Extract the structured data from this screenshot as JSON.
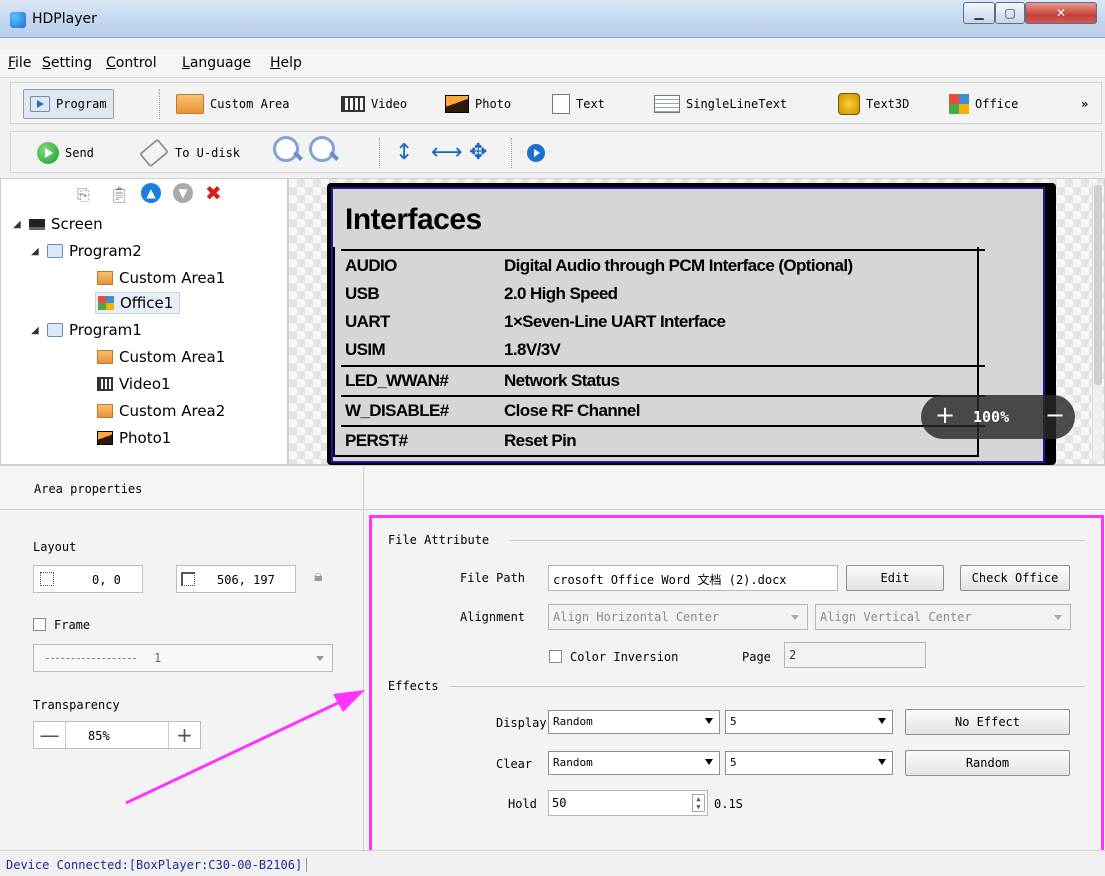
{
  "window": {
    "title": "HDPlayer"
  },
  "menu": [
    "File",
    "Setting",
    "Control",
    "Language",
    "Help"
  ],
  "toolbar1": {
    "program": "Program",
    "custom_area": "Custom Area",
    "video": "Video",
    "photo": "Photo",
    "text": "Text",
    "single_line_text": "SingleLineText",
    "text3d": "Text3D",
    "office": "Office",
    "more": "»"
  },
  "toolbar2": {
    "send": "Send",
    "to_udisk": "To U-disk"
  },
  "tree": {
    "screen": "Screen",
    "program2": "Program2",
    "p2_custom_area1": "Custom Area1",
    "p2_office1": "Office1",
    "program1": "Program1",
    "p1_custom_area1": "Custom Area1",
    "p1_video1": "Video1",
    "p1_custom_area2": "Custom Area2",
    "p1_photo1": "Photo1"
  },
  "preview": {
    "doc_title": "Interfaces",
    "rows": [
      {
        "k": "AUDIO",
        "v": "Digital Audio through PCM Interface (Optional)"
      },
      {
        "k": "USB",
        "v": "2.0 High Speed"
      },
      {
        "k": "UART",
        "v": "1×Seven-Line UART Interface"
      },
      {
        "k": "USIM",
        "v": "1.8V/3V"
      },
      {
        "k": "LED_WWAN#",
        "v": "Network Status"
      },
      {
        "k": "W_DISABLE#",
        "v": "Close RF Channel"
      },
      {
        "k": "PERST#",
        "v": "Reset Pin"
      }
    ],
    "zoom": {
      "minus": "+",
      "value": "100%",
      "plus": "−"
    }
  },
  "tabs": {
    "area_properties": "Area properties"
  },
  "area_props": {
    "layout_label": "Layout",
    "position": "0, 0",
    "size": "506, 197",
    "frame_label": "Frame",
    "frame_value": "1",
    "transparency_label": "Transparency",
    "transparency_value": "85%",
    "minus": "—",
    "plus": "+"
  },
  "file_attr": {
    "group": "File Attribute",
    "file_path_label": "File Path",
    "file_path": "crosoft Office Word 文档 (2).docx",
    "edit": "Edit",
    "check_office": "Check Office",
    "alignment_label": "Alignment",
    "align_h": "Align Horizontal Center",
    "align_v": "Align Vertical Center",
    "color_inversion": "Color Inversion",
    "page_label": "Page",
    "page_value": "2"
  },
  "effects": {
    "group": "Effects",
    "display_label": "Display",
    "display_effect": "Random",
    "display_speed": "5",
    "no_effect": "No Effect",
    "clear_label": "Clear",
    "clear_effect": "Random",
    "clear_speed": "5",
    "random": "Random",
    "hold_label": "Hold",
    "hold_value": "50",
    "hold_unit": "0.1S"
  },
  "status": {
    "text": "Device Connected:[BoxPlayer:C30-00-B2106]"
  },
  "colors": {
    "highlight": "#ff33ff",
    "stage_border": "#1a1aa0",
    "status_text": "#1a2a9a"
  }
}
